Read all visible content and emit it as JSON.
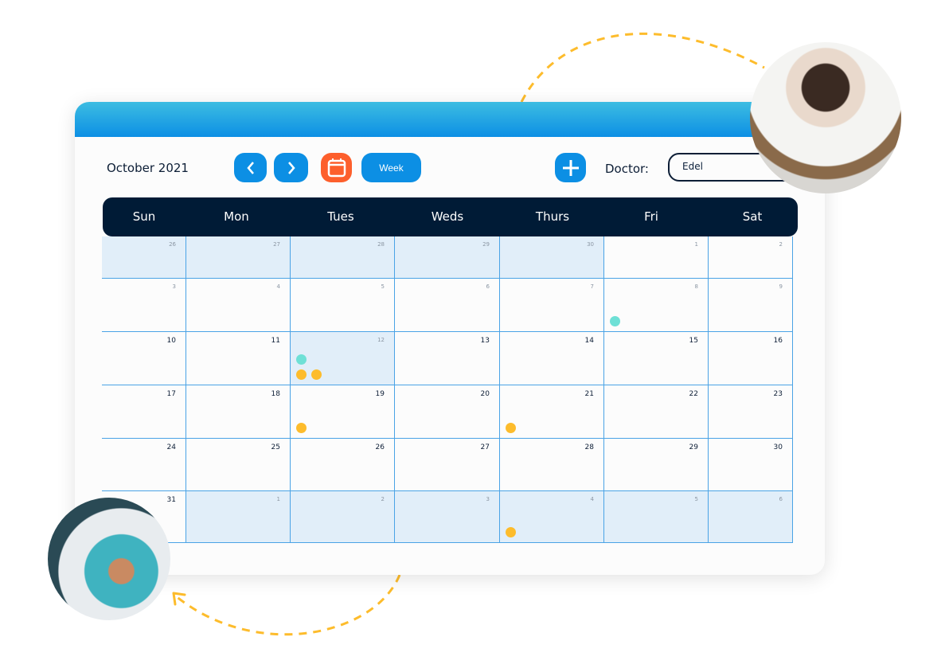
{
  "header": {
    "month": "October 2021",
    "prev_icon": "chevron-left-icon",
    "next_icon": "chevron-right-icon",
    "calendar_icon": "calendar-icon",
    "view_label": "Week",
    "add_icon": "plus-icon",
    "doctor_label": "Doctor:",
    "doctor_value": "Edel"
  },
  "colors": {
    "accent": "#0c8fe4",
    "calendar_button": "#fd5f2c",
    "header_bar": "#001b36",
    "event_teal": "#6ee0d6",
    "event_orange": "#fdbc2c",
    "dashes": "#fdbc2c"
  },
  "weekdays": [
    "Sun",
    "Mon",
    "Tues",
    "Weds",
    "Thurs",
    "Fri",
    "Sat"
  ],
  "weeks": [
    [
      {
        "d": "26",
        "out": true
      },
      {
        "d": "27",
        "out": true
      },
      {
        "d": "28",
        "out": true
      },
      {
        "d": "29",
        "out": true
      },
      {
        "d": "30",
        "out": true
      },
      {
        "d": "1",
        "small": true
      },
      {
        "d": "2",
        "small": true
      }
    ],
    [
      {
        "d": "3",
        "small": true
      },
      {
        "d": "4",
        "small": true
      },
      {
        "d": "5",
        "small": true
      },
      {
        "d": "6",
        "small": true
      },
      {
        "d": "7",
        "small": true
      },
      {
        "d": "8",
        "small": true,
        "events": [
          "teal"
        ]
      },
      {
        "d": "9",
        "small": true
      }
    ],
    [
      {
        "d": "10"
      },
      {
        "d": "11"
      },
      {
        "d": "12",
        "out": true,
        "events": [
          "teal",
          "orange",
          "orange"
        ]
      },
      {
        "d": "13"
      },
      {
        "d": "14"
      },
      {
        "d": "15"
      },
      {
        "d": "16"
      }
    ],
    [
      {
        "d": "17"
      },
      {
        "d": "18"
      },
      {
        "d": "19",
        "events": [
          "orange"
        ]
      },
      {
        "d": "20"
      },
      {
        "d": "21",
        "events": [
          "orange"
        ]
      },
      {
        "d": "22"
      },
      {
        "d": "23"
      }
    ],
    [
      {
        "d": "24"
      },
      {
        "d": "25"
      },
      {
        "d": "26"
      },
      {
        "d": "27"
      },
      {
        "d": "28"
      },
      {
        "d": "29"
      },
      {
        "d": "30"
      }
    ],
    [
      {
        "d": "31"
      },
      {
        "d": "1",
        "out": true
      },
      {
        "d": "2",
        "out": true
      },
      {
        "d": "3",
        "out": true
      },
      {
        "d": "4",
        "out": true,
        "events": [
          "orange"
        ]
      },
      {
        "d": "5",
        "out": true
      },
      {
        "d": "6",
        "out": true
      }
    ]
  ],
  "photos": [
    "woman-at-laptop-photo",
    "person-with-phone-photo"
  ]
}
